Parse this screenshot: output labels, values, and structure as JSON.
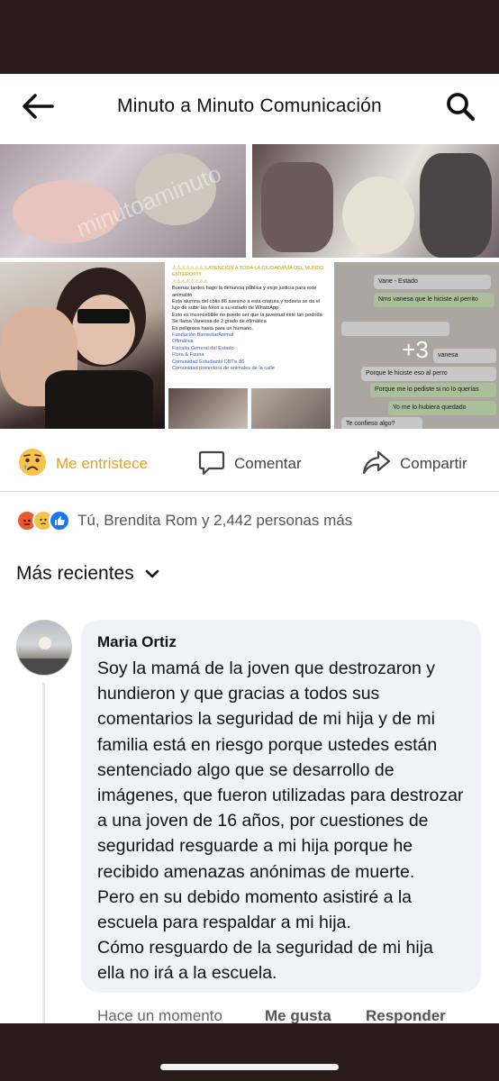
{
  "header": {
    "title": "Minuto a Minuto Comunicación",
    "back_icon": "arrow-left-icon",
    "search_icon": "search-icon"
  },
  "photos": {
    "watermark": "minutoaminuto",
    "document": {
      "heading": "⚠⚠⚠⚠⚠⚠⚠⚠ATENCIÓN A TODA LA CIUDADANÍA DEL MUNDO ENTERO!!!!!!",
      "warn_row": "⚠⚠⚠⚠⚠⚠⚠⚠",
      "lines": [
        "Buenas tardes hago la denuncia pública y exijo justicia para este animalito",
        "Esta alumna del cbtis 86 asesino a esta criatura y todavía se da el lujo de subir las fotos a su estado de WhatsApp",
        "Esto es inconcebible no puede ser que la juventud esté tan podrida",
        "Se llama Vanessa de 2 grado de ofimática",
        "Es peligrosa hasta para un humano."
      ],
      "tags": [
        "Fundación BienestarAnimal",
        "Ofimática",
        "Fiscalía General del Estado",
        "Flora & Fauna",
        "Comunidad Estudiantil CBTis 86",
        "Comunidad protectora de animales de la calle"
      ]
    },
    "chat": {
      "status": "Vane - Estado",
      "m1": "Nms vanesa que le hiciste al perrito",
      "m2": "Porque le hiciste eso al perro",
      "m3": "Porque me lo pediste si no lo querías",
      "m4": "Yo me lo hubiera quedado",
      "m5": "Te confieso algo?",
      "m6": "vanesa"
    },
    "more_count": "+3"
  },
  "actions": {
    "react_label": "Me entristece",
    "comment_label": "Comentar",
    "share_label": "Compartir"
  },
  "reactions": {
    "summary": "Tú, Brendita Rom y 2,442 personas más"
  },
  "sort": {
    "label": "Más recientes"
  },
  "comment": {
    "author": "Maria Ortiz",
    "body": "Soy la mamá de la joven que destrozaron y hundieron y que  gracias a todos sus comentarios la seguridad de mi hija y de mi familia está en riesgo porque ustedes están sentenciado algo que se desarrollo de imágenes, que fueron utilizadas para destrozar a una joven de 16 años, por cuestiones de seguridad resguarde a mi hija porque he recibido amenazas anónimas de muerte.\nPero en su debido momento asistiré a la escuela para respaldar a mi hija.\nCómo resguardo de la seguridad de mi hija ella no irá a la escuela.",
    "time": "Hace un momento",
    "like_label": "Me gusta",
    "reply_label": "Responder"
  },
  "colors": {
    "sad_accent": "#e4a21b",
    "like_blue": "#1877f2",
    "bubble_bg": "#f0f2f5"
  }
}
